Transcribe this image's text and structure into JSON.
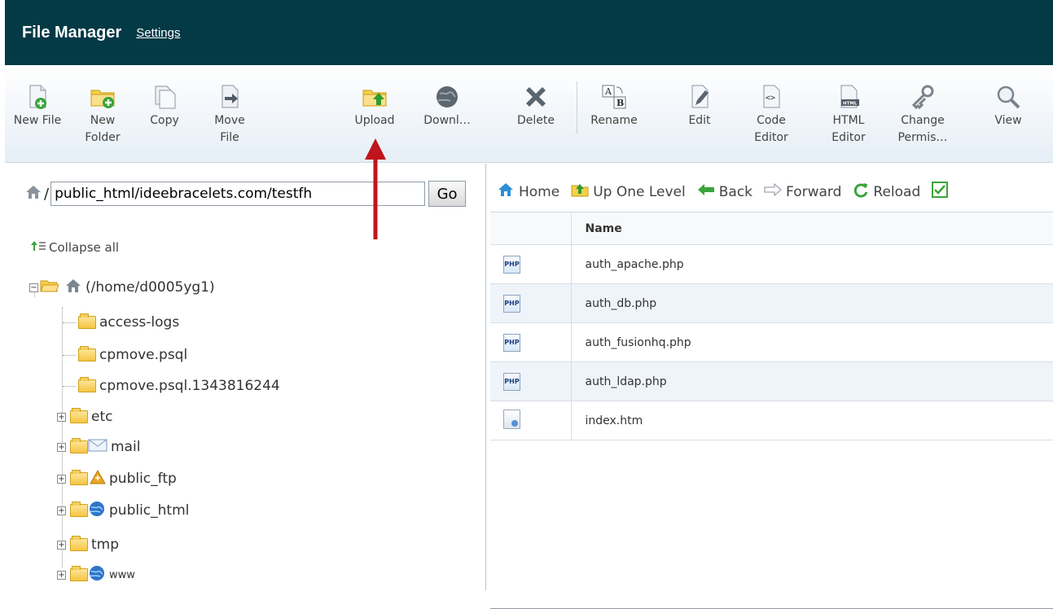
{
  "header": {
    "title": "File Manager",
    "settings_link": "Settings"
  },
  "toolbar": {
    "new_file": "New File",
    "new_folder": [
      "New",
      "Folder"
    ],
    "copy": "Copy",
    "move_file": [
      "Move",
      "File"
    ],
    "upload": "Upload",
    "download": "Downl…",
    "delete": "Delete",
    "rename": "Rename",
    "edit": "Edit",
    "code_editor": [
      "Code",
      "Editor"
    ],
    "html_editor": [
      "HTML",
      "Editor"
    ],
    "change_perms": [
      "Change",
      "Permis…"
    ],
    "view": "View"
  },
  "path": {
    "separator": "/",
    "value": "public_html/ideebracelets.com/testfh",
    "go_label": "Go"
  },
  "tree": {
    "collapse_label": "Collapse all",
    "root_label": "(/home/d0005yg1)",
    "items": [
      "access-logs",
      "cpmove.psql",
      "cpmove.psql.1343816244",
      "etc",
      "mail",
      "public_ftp",
      "public_html",
      "tmp",
      "www"
    ]
  },
  "nav": {
    "home": "Home",
    "up_one_level": "Up One Level",
    "back": "Back",
    "forward": "Forward",
    "reload": "Reload"
  },
  "table": {
    "header_name": "Name",
    "rows": [
      {
        "name": "auth_apache.php",
        "icon": "php-file-icon"
      },
      {
        "name": "auth_db.php",
        "icon": "php-file-icon"
      },
      {
        "name": "auth_fusionhq.php",
        "icon": "php-file-icon"
      },
      {
        "name": "auth_ldap.php",
        "icon": "php-file-icon"
      },
      {
        "name": "index.htm",
        "icon": "html-file-icon"
      }
    ],
    "php_badge": "PHP"
  },
  "colors": {
    "header_bg": "#033a46",
    "annotation_arrow": "#c0151b"
  }
}
